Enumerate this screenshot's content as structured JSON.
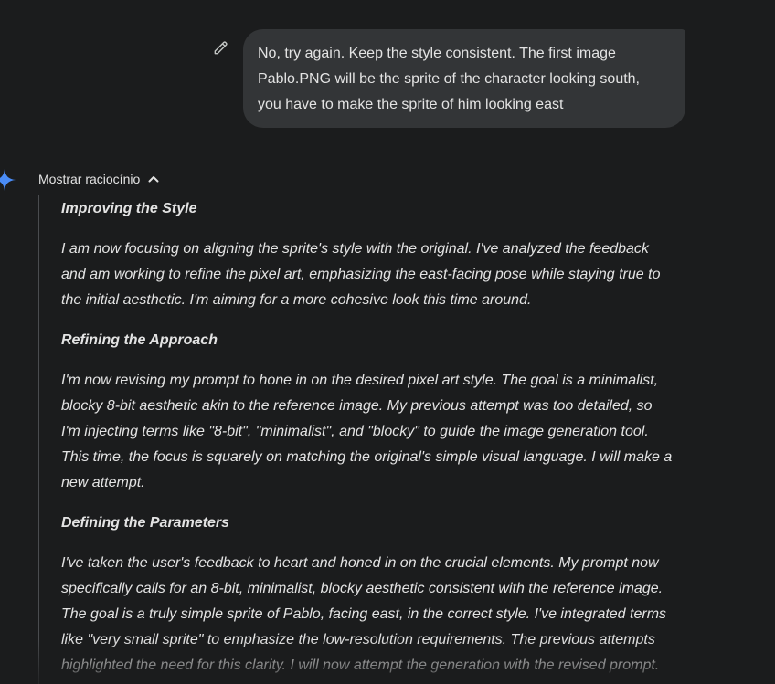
{
  "user_message": {
    "lines": [
      "No, try again. Keep the style consistent. The first image",
      "Pablo.PNG will be the sprite of the character looking south,",
      "you have to make the sprite of him looking east"
    ],
    "edit_icon": "pencil-icon"
  },
  "response": {
    "avatar_icon": "gemini-sparkle-icon",
    "toggle_label": "Mostrar raciocínio",
    "toggle_icon": "chevron-up-icon",
    "thoughts": [
      {
        "title": "Improving the Style",
        "body": [
          "I am now focusing on aligning the sprite's style with the original. I've analyzed the feedback",
          "and am working to refine the pixel art, emphasizing the east-facing pose while staying true to",
          "the initial aesthetic. I'm aiming for a more cohesive look this time around."
        ]
      },
      {
        "title": "Refining the Approach",
        "body": [
          "I'm now revising my prompt to hone in on the desired pixel art style. The goal is a minimalist,",
          "blocky 8-bit aesthetic akin to the reference image. My previous attempt was too detailed, so",
          "I'm injecting terms like \"8-bit\", \"minimalist\", and \"blocky\" to guide the image generation tool.",
          "This time, the focus is squarely on matching the original's simple visual language. I will make a",
          "new attempt."
        ]
      },
      {
        "title": "Defining the Parameters",
        "body": [
          "I've taken the user's feedback to heart and honed in on the crucial elements. My prompt now",
          "specifically calls for an 8-bit, minimalist, blocky aesthetic consistent with the reference image.",
          "The goal is a truly simple sprite of Pablo, facing east, in the correct style. I've integrated terms",
          "like \"very small sprite\" to emphasize the low-resolution requirements. The previous attempts",
          "highlighted the need for this clarity. I will now attempt the generation with the revised prompt."
        ]
      }
    ]
  },
  "colors": {
    "background": "#1b1c1d",
    "user_bubble": "#333537",
    "text": "#e3e3e3",
    "gemini_blue": "#4a8cf7"
  }
}
